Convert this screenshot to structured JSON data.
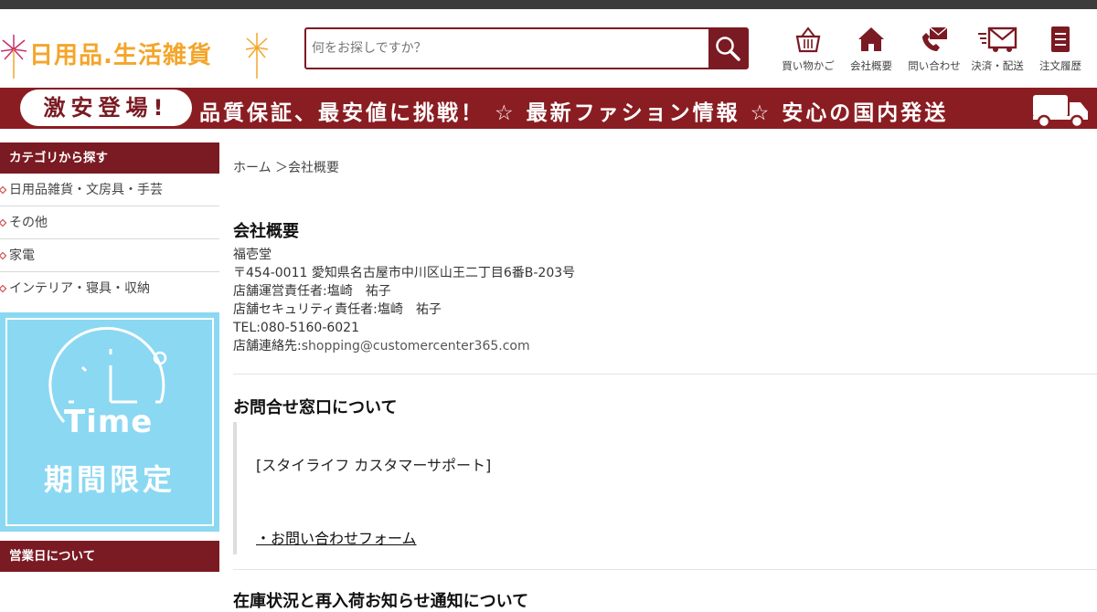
{
  "header": {
    "logo_text": "日用品.生活雑貨",
    "search_placeholder": "何をお探しですか？",
    "nav": [
      {
        "label": "買い物かご",
        "icon": "basket-icon"
      },
      {
        "label": "会社概要",
        "icon": "home-icon"
      },
      {
        "label": "問い合わせ",
        "icon": "phone-mail-icon"
      },
      {
        "label": "決済・配送",
        "icon": "delivery-mail-icon"
      },
      {
        "label": "注文履歴",
        "icon": "list-icon"
      }
    ]
  },
  "banner": {
    "badge": "激安登場!",
    "text": "品質保証、最安値に挑戦！ ☆ 最新ファション情報 ☆ 安心の国内発送",
    "icon": "truck-icon"
  },
  "sidebar": {
    "category_heading": "カテゴリから探す",
    "categories": [
      "日用品雑貨・文房具・手芸",
      "その他",
      "家電",
      "インテリア・寝具・収納"
    ],
    "promo": {
      "word": "Time",
      "label": "期間限定"
    },
    "business_heading": "営業日について"
  },
  "main": {
    "breadcrumb": "ホーム ＞会社概要",
    "company_heading": "会社概要",
    "company_name": "福壱堂",
    "address": "〒454-0011 愛知県名古屋市中川区山王二丁目6番B-203号",
    "manager": "店舗運営責任者:塩崎　祐子",
    "security": "店舗セキュリティ責任者:塩崎　祐子",
    "tel": "TEL:080-5160-6021",
    "contact_label": "店舗連絡先:",
    "contact_email": "shopping@customercenter365.com",
    "inquiry_heading": "お問合せ窓口について",
    "support_name": "[スタイライフ カスタマーサポート]",
    "form_link": "・お問い合わせフォーム",
    "next_heading": "在庫状況と再入荷お知らせ通知について"
  },
  "colors": {
    "brand": "#7a1a22",
    "logo": "#f4a52a",
    "promo_bg": "#8bd8f2"
  }
}
